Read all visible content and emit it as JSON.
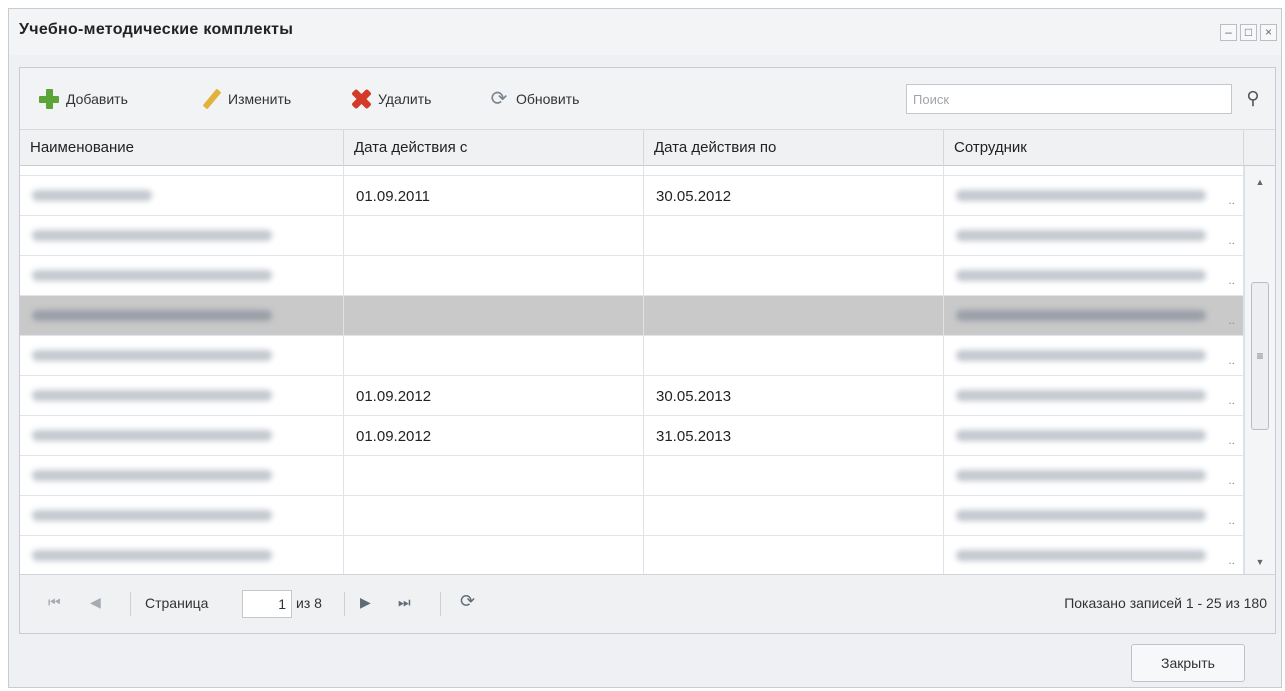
{
  "window": {
    "title": "Учебно-методические комплекты",
    "minimize": "–",
    "maximize": "□",
    "close": "×"
  },
  "toolbar": {
    "add_label": "Добавить",
    "edit_label": "Изменить",
    "delete_label": "Удалить",
    "refresh_label": "Обновить",
    "search_placeholder": "Поиск",
    "search_icon": "⚲"
  },
  "grid": {
    "columns": [
      "Наименование",
      "Дата действия с",
      "Дата действия по",
      "Сотрудник"
    ],
    "partial_row": {
      "date_from": "01.09.2011",
      "date_to": "30.05.2012"
    },
    "rows": [
      {
        "date_from": "01.09.2011",
        "date_to": "30.05.2012"
      },
      {
        "date_from": "",
        "date_to": ""
      },
      {
        "date_from": "",
        "date_to": ""
      },
      {
        "date_from": "",
        "date_to": ""
      },
      {
        "date_from": "",
        "date_to": ""
      },
      {
        "date_from": "01.09.2012",
        "date_to": "30.05.2013"
      },
      {
        "date_from": "01.09.2012",
        "date_to": "31.05.2013"
      },
      {
        "date_from": "",
        "date_to": ""
      },
      {
        "date_from": "",
        "date_to": ""
      },
      {
        "date_from": "",
        "date_to": ""
      }
    ],
    "ellipsis": "..",
    "selected_row": 3
  },
  "pager": {
    "first": "⏮",
    "prev": "◀",
    "page_label": "Страница",
    "page_value": "1",
    "of_label": "из 8",
    "next": "▶",
    "last": "⏭",
    "refresh": "⟳",
    "status": "Показано записей 1 - 25 из 180"
  },
  "footer": {
    "close_label": "Закрыть"
  }
}
